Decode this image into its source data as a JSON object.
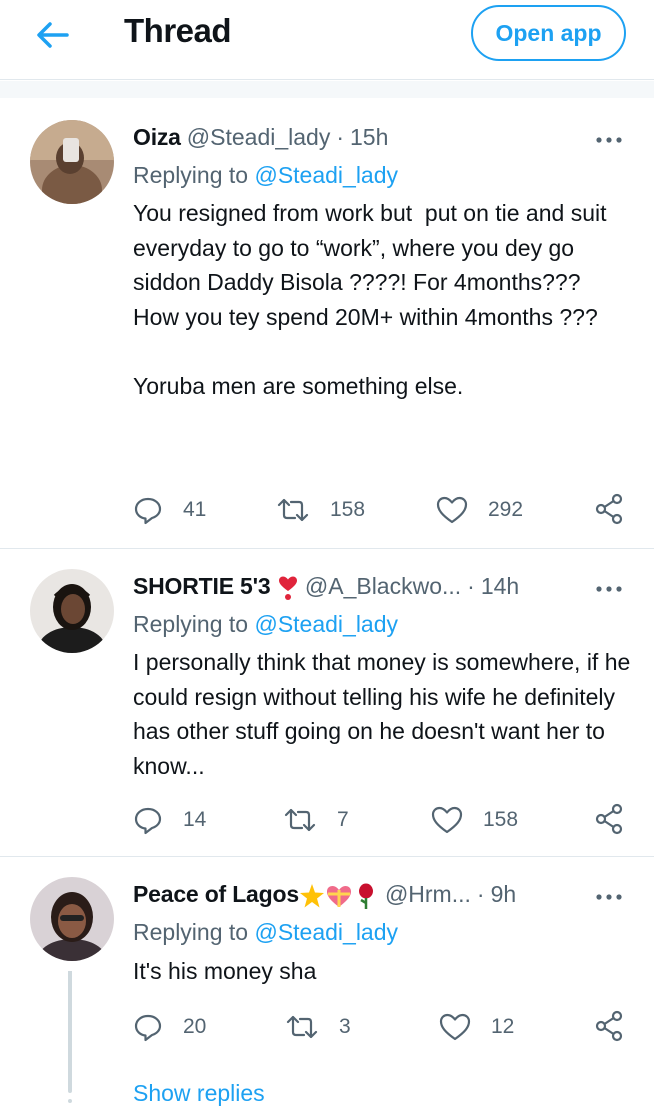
{
  "header": {
    "title": "Thread",
    "open_app_label": "Open app"
  },
  "tweets": [
    {
      "name": "Oiza",
      "handle": "@Steadi_lady",
      "time": "15h",
      "replying_prefix": "Replying to ",
      "replying_to": "@Steadi_lady",
      "text": "You resigned from work but  put on tie and suit everyday to go to “work”, where you dey go siddon Daddy Bisola ????! For 4months???\nHow you tey spend 20M+ within 4months ???\n\nYoruba men are something else.",
      "replies": "41",
      "retweets": "158",
      "likes": "292"
    },
    {
      "name": "SHORTIE 5'3",
      "handle": "@A_Blackwo...",
      "time": "14h",
      "replying_prefix": "Replying to ",
      "replying_to": "@Steadi_lady",
      "text": "I personally think that money is somewhere, if he could resign without telling his wife he definitely has other stuff going on he doesn't want her to know...",
      "replies": "14",
      "retweets": "7",
      "likes": "158"
    },
    {
      "name": "Peace of Lagos",
      "handle": "@Hrm...",
      "time": "9h",
      "replying_prefix": "Replying to ",
      "replying_to": "@Steadi_lady",
      "text": "It's his money sha",
      "replies": "20",
      "retweets": "3",
      "likes": "12"
    }
  ],
  "show_replies_label": "Show replies",
  "colors": {
    "accent": "#1da1f2",
    "secondary_text": "#536471",
    "divider": "#e1e8ed"
  },
  "icons": [
    "back-arrow-icon",
    "more-icon",
    "reply-icon",
    "retweet-icon",
    "like-icon",
    "share-icon",
    "heart-emoji-icon",
    "star-emoji-icon",
    "heart-gift-emoji-icon",
    "rose-emoji-icon"
  ]
}
